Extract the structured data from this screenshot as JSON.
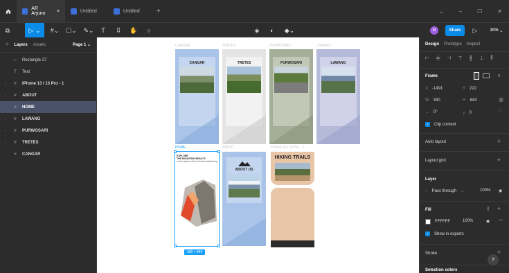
{
  "titlebar": {
    "home_icon": "home-icon",
    "tabs": [
      {
        "label": "AR Arjuno",
        "active": true
      },
      {
        "label": "Untitled",
        "active": false
      },
      {
        "label": "Untitled",
        "active": false
      }
    ],
    "add_icon": "plus-icon"
  },
  "toolbar": {
    "share_label": "Share",
    "zoom": "30%",
    "avatar_letter": "M"
  },
  "layers_panel": {
    "tab_layers": "Layers",
    "tab_assets": "Assets",
    "page": "Page 1",
    "items": [
      {
        "label": "Rectangle 27",
        "icon": "line"
      },
      {
        "label": "Text",
        "icon": "text"
      },
      {
        "label": "iPhone 13 / 13 Pro - 1",
        "icon": "frame"
      },
      {
        "label": "ABOUT",
        "icon": "frame"
      },
      {
        "label": "HOME",
        "icon": "frame",
        "selected": true
      },
      {
        "label": "LAWANG",
        "icon": "frame"
      },
      {
        "label": "PURWOSARI",
        "icon": "frame"
      },
      {
        "label": "TRETES",
        "icon": "frame"
      },
      {
        "label": "CANGAR",
        "icon": "frame"
      }
    ]
  },
  "canvas": {
    "row1": [
      {
        "name": "CANGAR",
        "title": "CANGAR",
        "bg": "#a9c4e8"
      },
      {
        "name": "TRETES",
        "title": "TRETES",
        "bg": "#e4e4e4"
      },
      {
        "name": "PURWOSARI",
        "title": "PURWOSARI",
        "bg": "#a5ae98"
      },
      {
        "name": "LAWANG",
        "title": "LAWANG",
        "bg": "#b6bad9"
      }
    ],
    "row2": [
      {
        "name": "HOME"
      },
      {
        "name": "ABOUT"
      },
      {
        "name": "iPhone 13 / 13 Pro - 1"
      }
    ],
    "home_text_line1": "EXPLORE",
    "home_text_line2": "THE MOUNTAIN BEAUTY",
    "home_text_line3": "Lorem ipsum dolor sit amet adipiscing",
    "about_title": "ABOUT US",
    "hiking_title": "HIKING TRAILS",
    "size_badge": "390 × 844"
  },
  "design_panel": {
    "tabs": [
      "Design",
      "Prototype",
      "Inspect"
    ],
    "frame_label": "Frame",
    "x_label": "X",
    "x": "-1491",
    "y_label": "Y",
    "y": "222",
    "w_label": "W",
    "w": "390",
    "h_label": "H",
    "h": "844",
    "rotation": "0°",
    "radius": "0",
    "clip_content": "Clip content",
    "auto_layout": "Auto layout",
    "layout_grid": "Layout grid",
    "layer": "Layer",
    "blend": "Pass through",
    "opacity": "100%",
    "fill": "Fill",
    "fill_hex": "FFFFFF",
    "fill_opacity": "100%",
    "show_exports": "Show in exports",
    "stroke": "Stroke",
    "selection_colors": "Selection colors",
    "help": "?"
  }
}
